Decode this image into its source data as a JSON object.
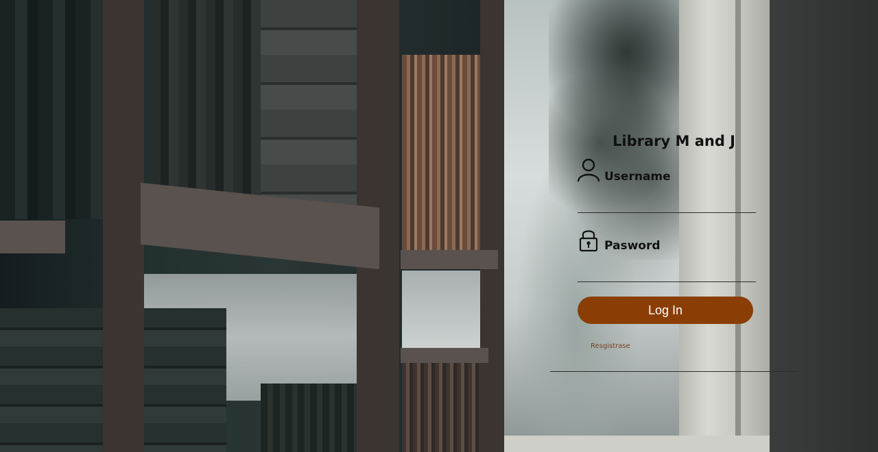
{
  "login": {
    "title": "Library M and J",
    "username_label": "Username",
    "username_value": "",
    "password_label": "Pasword",
    "password_value": "",
    "login_button": "Log In",
    "register_link": "Resgistrase"
  },
  "icons": {
    "user": "user-icon",
    "lock": "lock-icon"
  },
  "colors": {
    "button_bg": "#8a3e06",
    "button_text": "#ffffff",
    "register_link": "#7a3e1e",
    "text": "#111111"
  }
}
